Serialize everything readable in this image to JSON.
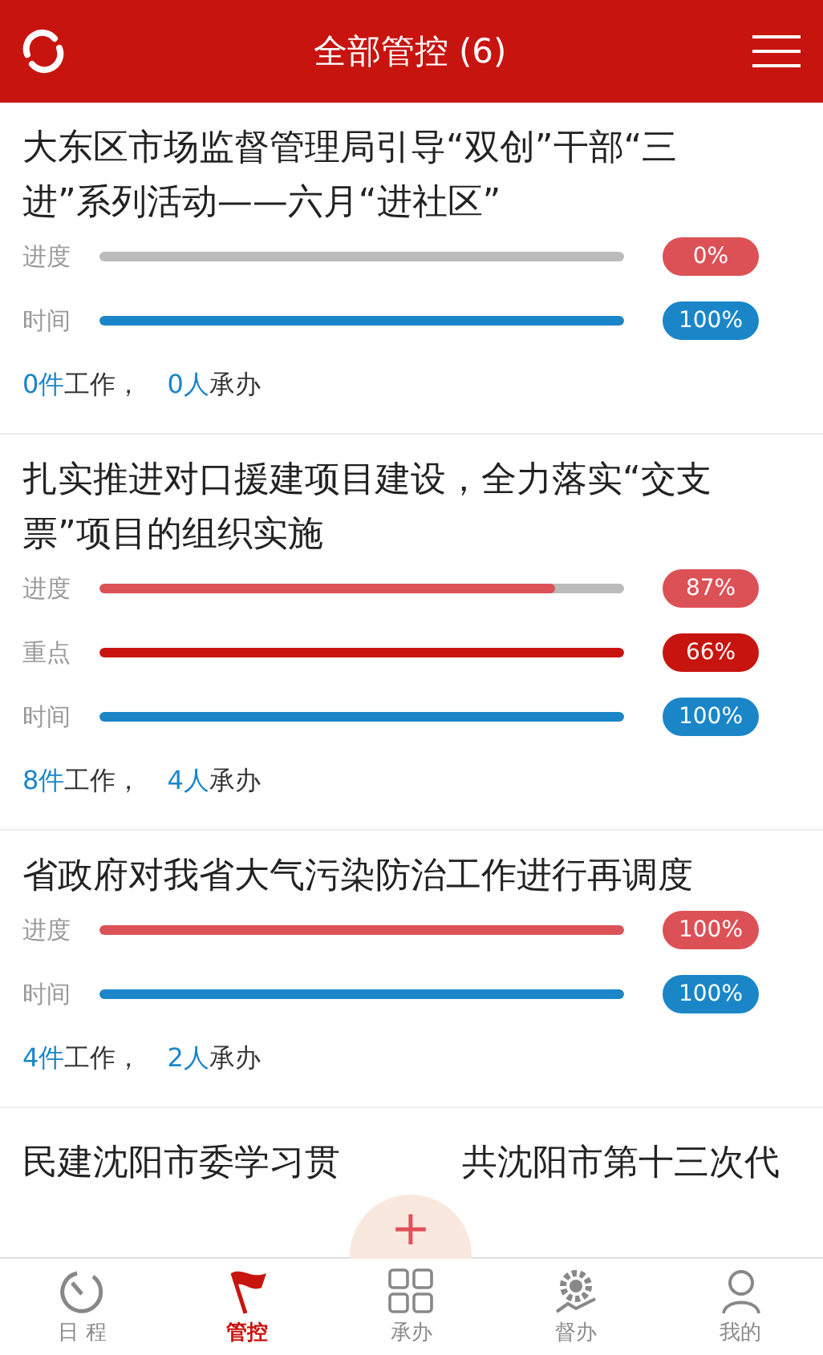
{
  "header": {
    "title": "全部管控 (6)"
  },
  "tasks": [
    {
      "title": "大东区市场监督管理局引导“双创”干部“三进”系列活动——六月“进社区”",
      "metrics": [
        {
          "kind": "progress",
          "label": "进度",
          "level": 0,
          "reading": "0%"
        },
        {
          "kind": "time",
          "label": "时间",
          "level": 1,
          "reading": "100%"
        }
      ],
      "work_count": "0件",
      "work_label": "工作，",
      "people_count": "0人",
      "people_label": "承办"
    },
    {
      "title": "扎实推进对口援建项目建设，全力落实“交支票”项目的组织实施",
      "metrics": [
        {
          "kind": "progress",
          "label": "进度",
          "level": 0.87,
          "reading": "87%"
        },
        {
          "kind": "key",
          "label": "重点",
          "level": 1,
          "reading": "66%"
        },
        {
          "kind": "time",
          "label": "时间",
          "level": 1,
          "reading": "100%"
        }
      ],
      "work_count": "8件",
      "work_label": "工作，",
      "people_count": "4人",
      "people_label": "承办"
    },
    {
      "title": "省政府对我省大气污染防治工作进行再调度",
      "metrics": [
        {
          "kind": "progress",
          "label": "进度",
          "level": 1,
          "reading": "100%"
        },
        {
          "kind": "time",
          "label": "时间",
          "level": 1,
          "reading": "100%"
        }
      ],
      "work_count": "4件",
      "work_label": "工作，",
      "people_count": "2人",
      "people_label": "承办"
    },
    {
      "kind": "partial",
      "title_start": "民建沈阳市委学习贯",
      "title_end": "共沈阳市第十三次代"
    }
  ],
  "fab": {
    "symbol": "+"
  },
  "tabs": [
    {
      "label": "日 程",
      "selected": false
    },
    {
      "label": "管控",
      "selected": true
    },
    {
      "label": "承办",
      "selected": false
    },
    {
      "label": "督办",
      "selected": false
    },
    {
      "label": "我的",
      "selected": false
    }
  ]
}
